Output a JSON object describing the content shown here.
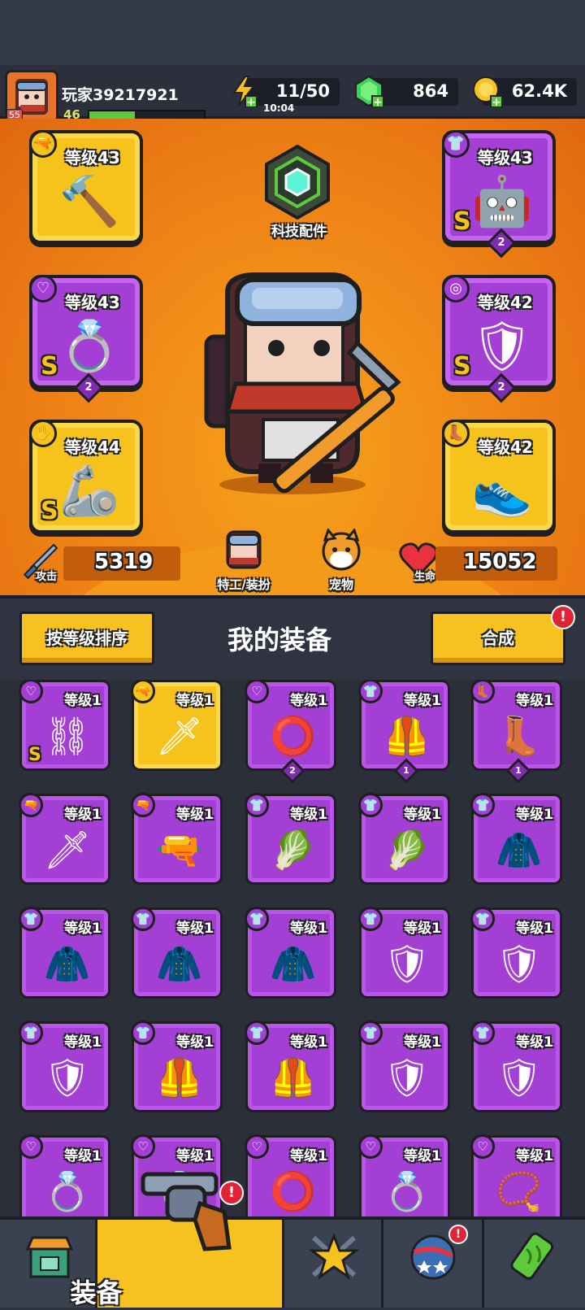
{
  "player": {
    "name": "玩家39217921",
    "level": "46",
    "avatar_badge": "55",
    "xp_fraction": 0.4
  },
  "resources": {
    "energy": "11/50",
    "energy_timer": "10:04",
    "gems": "864",
    "coins": "62.4K"
  },
  "hero": {
    "tech_label": "科技配件",
    "attack_label": "攻击",
    "attack_value": "5319",
    "hp_label": "生命",
    "hp_value": "15052",
    "agent_label": "特工/装扮",
    "pet_label": "宠物"
  },
  "slots": {
    "weapon": {
      "level": "等级43",
      "rarity": "",
      "stars": ""
    },
    "armor": {
      "level": "等级43",
      "rarity": "S",
      "stars": "2"
    },
    "necklace": {
      "level": "等级43",
      "rarity": "S",
      "stars": "2"
    },
    "belt": {
      "level": "等级42",
      "rarity": "S",
      "stars": "2"
    },
    "gloves": {
      "level": "等级44",
      "rarity": "S",
      "stars": ""
    },
    "boots": {
      "level": "等级42",
      "rarity": "",
      "stars": ""
    }
  },
  "equipment": {
    "sort_button": "按等级排序",
    "title": "我的装备",
    "merge_button": "合成",
    "alert_mark": "!",
    "items": [
      {
        "type": "necklace",
        "color": "purple",
        "level": "等级1",
        "rarity": "S",
        "stars": "",
        "icon": "chain-necklace-icon"
      },
      {
        "type": "weapon",
        "color": "yellow",
        "level": "等级1",
        "rarity": "",
        "stars": "",
        "icon": "kunai-icon"
      },
      {
        "type": "necklace",
        "color": "purple",
        "level": "等级1",
        "rarity": "",
        "stars": "2",
        "icon": "spiked-collar-icon"
      },
      {
        "type": "armor",
        "color": "purple",
        "level": "等级1",
        "rarity": "",
        "stars": "1",
        "icon": "vest-icon"
      },
      {
        "type": "boots",
        "color": "purple",
        "level": "等级1",
        "rarity": "",
        "stars": "1",
        "icon": "boot-icon"
      },
      {
        "type": "weapon",
        "color": "purple",
        "level": "等级1",
        "rarity": "",
        "stars": "",
        "icon": "kunai-icon"
      },
      {
        "type": "weapon",
        "color": "purple",
        "level": "等级1",
        "rarity": "",
        "stars": "",
        "icon": "shotgun-icon"
      },
      {
        "type": "armor",
        "color": "purple",
        "level": "等级1",
        "rarity": "",
        "stars": "",
        "icon": "leaf-armor-icon"
      },
      {
        "type": "armor",
        "color": "purple",
        "level": "等级1",
        "rarity": "",
        "stars": "",
        "icon": "leaf-armor-icon"
      },
      {
        "type": "armor",
        "color": "purple",
        "level": "等级1",
        "rarity": "",
        "stars": "",
        "icon": "steel-coat-icon"
      },
      {
        "type": "armor",
        "color": "purple",
        "level": "等级1",
        "rarity": "",
        "stars": "",
        "icon": "steel-coat-icon"
      },
      {
        "type": "armor",
        "color": "purple",
        "level": "等级1",
        "rarity": "",
        "stars": "",
        "icon": "steel-coat-icon"
      },
      {
        "type": "armor",
        "color": "purple",
        "level": "等级1",
        "rarity": "",
        "stars": "",
        "icon": "steel-coat-icon"
      },
      {
        "type": "armor",
        "color": "purple",
        "level": "等级1",
        "rarity": "",
        "stars": "",
        "icon": "gem-chest-icon"
      },
      {
        "type": "armor",
        "color": "purple",
        "level": "等级1",
        "rarity": "",
        "stars": "",
        "icon": "gem-chest-icon"
      },
      {
        "type": "armor",
        "color": "purple",
        "level": "等级1",
        "rarity": "",
        "stars": "",
        "icon": "gem-chest-icon"
      },
      {
        "type": "armor",
        "color": "purple",
        "level": "等级1",
        "rarity": "",
        "stars": "",
        "icon": "plate-vest-icon"
      },
      {
        "type": "armor",
        "color": "purple",
        "level": "等级1",
        "rarity": "",
        "stars": "",
        "icon": "plate-vest-icon"
      },
      {
        "type": "armor",
        "color": "purple",
        "level": "等级1",
        "rarity": "",
        "stars": "",
        "icon": "shield-vest-icon"
      },
      {
        "type": "armor",
        "color": "purple",
        "level": "等级1",
        "rarity": "",
        "stars": "",
        "icon": "shield-vest-icon"
      },
      {
        "type": "necklace",
        "color": "purple",
        "level": "等级1",
        "rarity": "",
        "stars": "",
        "icon": "ring-icon"
      },
      {
        "type": "necklace",
        "color": "purple",
        "level": "等级1",
        "rarity": "",
        "stars": "",
        "icon": "ring-icon"
      },
      {
        "type": "necklace",
        "color": "purple",
        "level": "等级1",
        "rarity": "",
        "stars": "",
        "icon": "collar-icon"
      },
      {
        "type": "necklace",
        "color": "purple",
        "level": "等级1",
        "rarity": "",
        "stars": "",
        "icon": "gem-ring-icon"
      },
      {
        "type": "necklace",
        "color": "purple",
        "level": "等级1",
        "rarity": "",
        "stars": "",
        "icon": "pendant-icon"
      }
    ]
  },
  "nav": {
    "shop": "shop-icon",
    "equip_label": "装备",
    "hero": "star-icon",
    "world": "planet-icon",
    "gear": "gene-icon"
  },
  "colors": {
    "accent": "#f7c21f",
    "orange_bg": "#ef8316",
    "purple": "#a43fd6",
    "alert": "#e02435"
  }
}
